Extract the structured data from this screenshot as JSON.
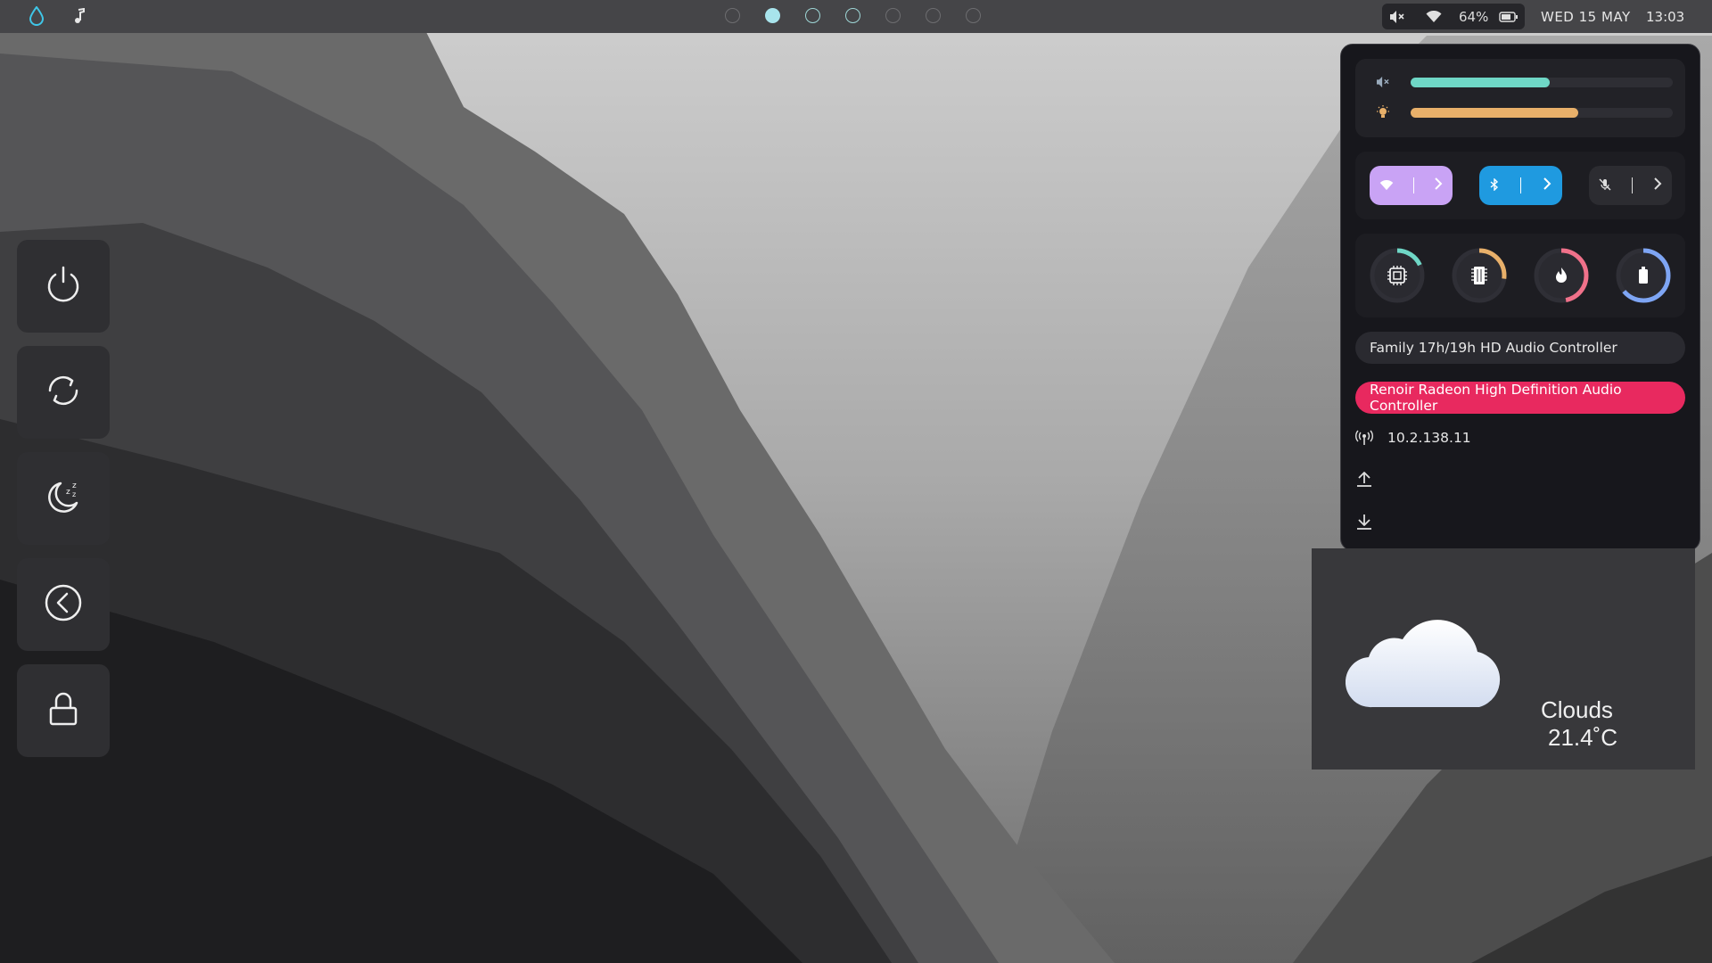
{
  "topbar": {
    "launcher_icon": "droplet-icon",
    "music_icon": "music-note-icon",
    "workspaces": [
      {
        "state": "empty"
      },
      {
        "state": "active"
      },
      {
        "state": "occupied"
      },
      {
        "state": "occupied"
      },
      {
        "state": "empty"
      },
      {
        "state": "empty"
      },
      {
        "state": "empty"
      }
    ],
    "status": {
      "volume_icon": "speaker-muted-icon",
      "wifi_icon": "wifi-icon",
      "battery_percent": "64%",
      "battery_icon": "battery-icon"
    },
    "date": "WED 15 MAY",
    "time": "13:03"
  },
  "power_menu": [
    {
      "name": "shutdown",
      "icon": "power-icon"
    },
    {
      "name": "reboot",
      "icon": "reboot-icon"
    },
    {
      "name": "suspend",
      "icon": "moon-sleep-icon"
    },
    {
      "name": "logout",
      "icon": "logout-icon"
    },
    {
      "name": "lock",
      "icon": "lock-icon"
    }
  ],
  "control_panel": {
    "sliders": {
      "volume": {
        "icon": "speaker-muted-icon",
        "level": 0.53,
        "color": "#6fd7c6"
      },
      "brightness": {
        "icon": "bulb-icon",
        "level": 0.64,
        "color": "#e8b06a"
      }
    },
    "quick_toggles": {
      "wifi": {
        "icon": "wifi-icon",
        "color": "#c9a3f5",
        "active": true
      },
      "bluetooth": {
        "icon": "bluetooth-icon",
        "color": "#1f9ae0",
        "active": true
      },
      "microphone": {
        "icon": "mic-off-icon",
        "color": "#2c2c31",
        "active": false
      }
    },
    "monitors": {
      "cpu": {
        "icon": "cpu-chip-icon",
        "level": 0.18,
        "color": "#6fd7c6"
      },
      "memory": {
        "icon": "memory-icon",
        "level": 0.27,
        "color": "#e8b06a"
      },
      "temperature": {
        "icon": "flame-icon",
        "level": 0.47,
        "color": "#f0718a"
      },
      "battery": {
        "icon": "battery-icon",
        "level": 0.64,
        "color": "#7ea5f4"
      }
    },
    "audio_devices": [
      {
        "label": "Family 17h/19h HD Audio Controller",
        "selected": false
      },
      {
        "label": "Renoir Radeon High Definition Audio Controller",
        "selected": true
      }
    ],
    "network": {
      "ip_icon": "antenna-icon",
      "ip": "10.2.138.11",
      "upload_icon": "upload-icon",
      "download_icon": "download-icon"
    },
    "colors": {
      "selected_device": "#e8295f",
      "device_bg": "#2a2a30"
    }
  },
  "weather": {
    "icon": "cloud-icon",
    "condition": "Clouds",
    "temperature": "21.4˚C"
  }
}
